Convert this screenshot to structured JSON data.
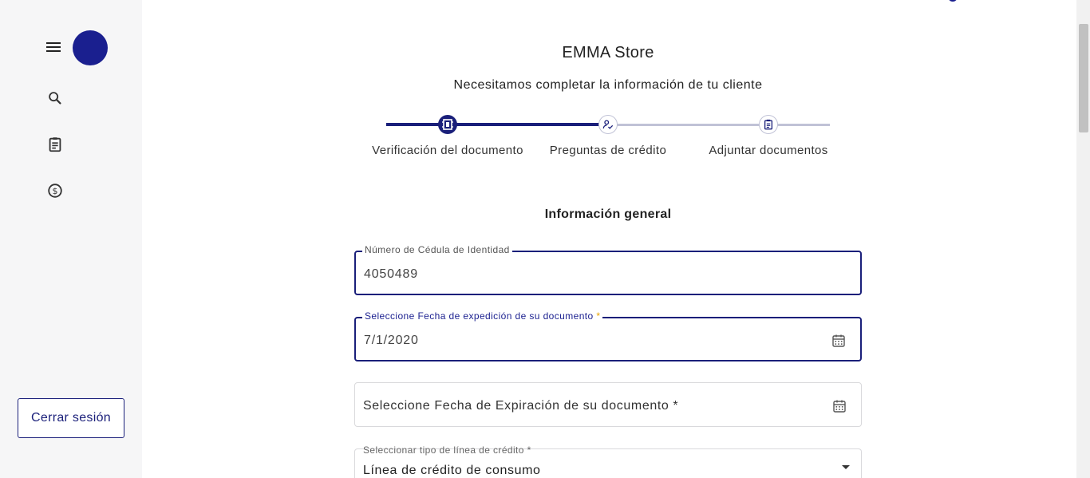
{
  "sidebar": {
    "logout_label": "Cerrar sesión"
  },
  "header": {
    "store_name": "EMMA Store",
    "subtitle": "Necesitamos completar la información de tu cliente"
  },
  "stepper": {
    "steps": [
      {
        "label": "Verificación del documento",
        "status": "active"
      },
      {
        "label": "Preguntas de crédito",
        "status": "pending"
      },
      {
        "label": "Adjuntar documentos",
        "status": "pending"
      }
    ]
  },
  "form": {
    "section_title": "Información general",
    "cedula": {
      "label": "Número de Cédula de Identidad",
      "value": "4050489"
    },
    "expedicion": {
      "label": "Seleccione Fecha de expedición de su documento",
      "required_mark": "*",
      "value": "7/1/2020"
    },
    "expiracion": {
      "placeholder": "Seleccione Fecha de Expiración de su documento *"
    },
    "credit_line": {
      "label": "Seleccionar tipo de línea de crédito *",
      "value": "Línea de crédito de consumo"
    }
  },
  "colors": {
    "primary": "#1a1f7a",
    "avatar": "#1a1f8f",
    "required": "#e8a300",
    "track_inactive": "#c0c2d6"
  }
}
